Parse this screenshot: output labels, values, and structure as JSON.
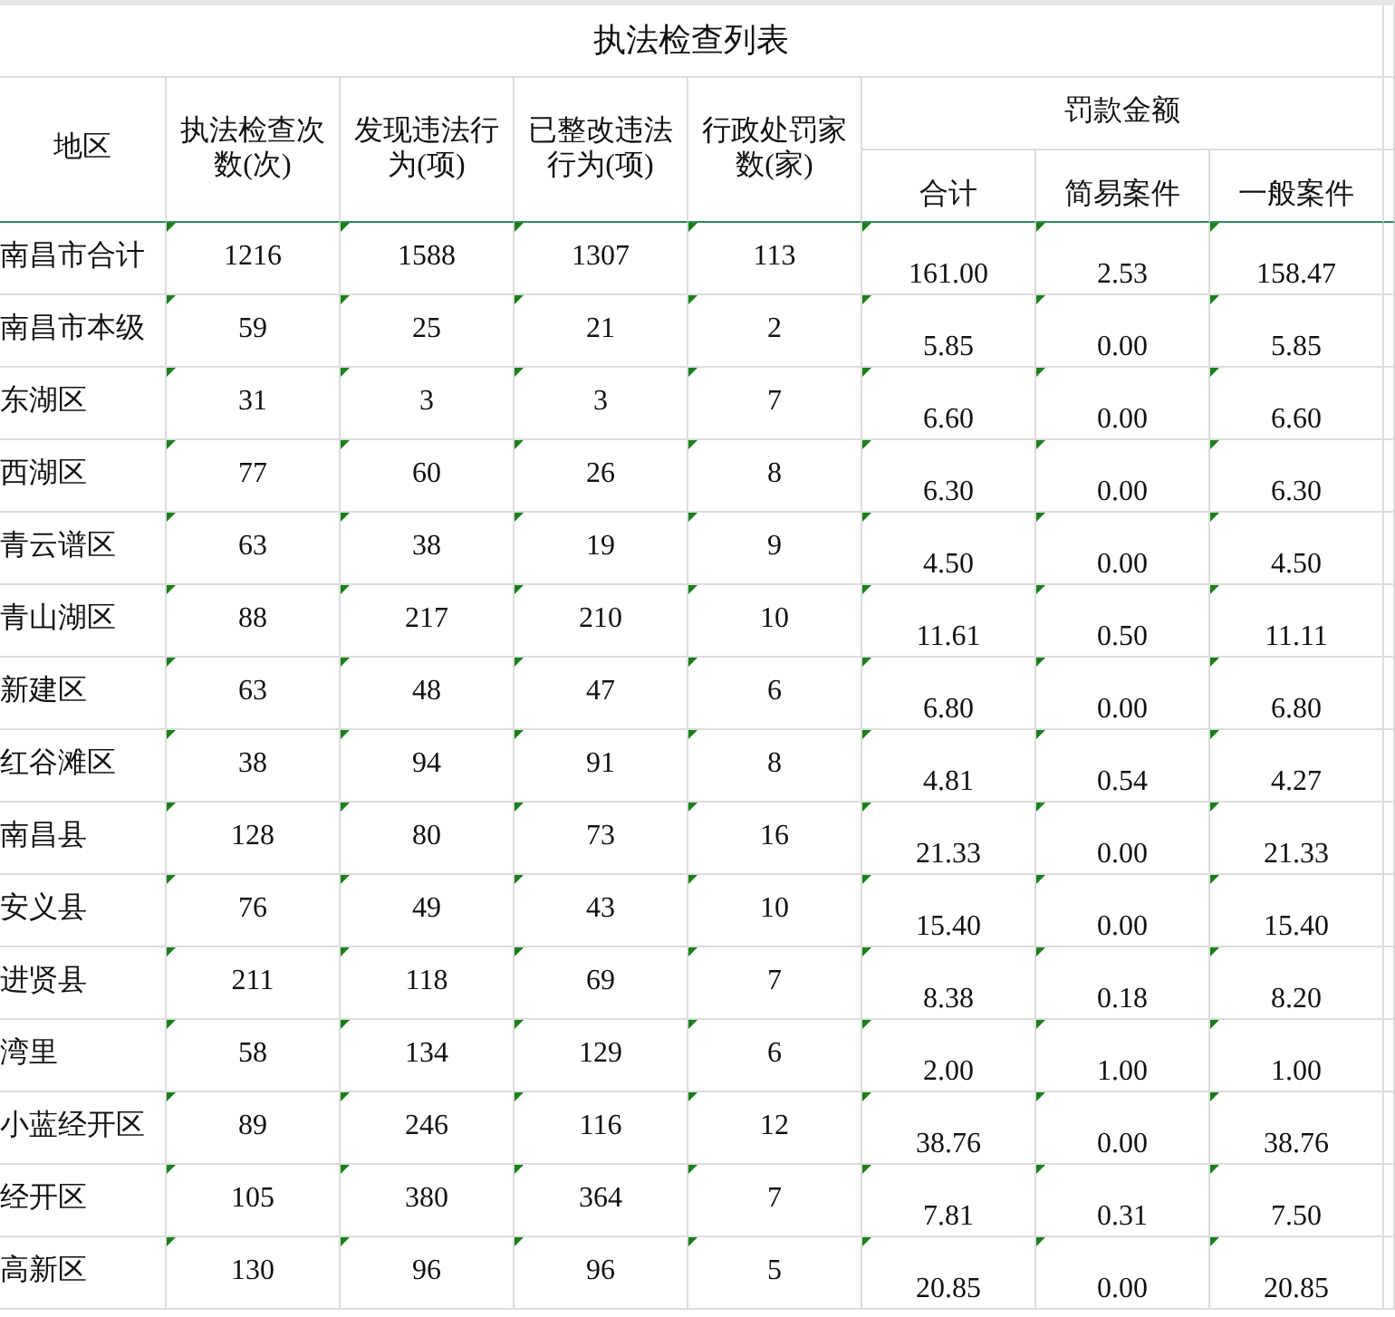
{
  "title": "执法检查列表",
  "headers": {
    "region": "地区",
    "counts": [
      "执法检查次数(次)",
      "发现违法行为(项)",
      "已整改违法行为(项)",
      "行政处罚家数(家)"
    ],
    "fines_group": "罚款金额",
    "fines": [
      "合计",
      "简易案件",
      "一般案件"
    ]
  },
  "rows": [
    {
      "region": "南昌市合计",
      "counts": [
        "1216",
        "1588",
        "1307",
        "113"
      ],
      "fines": [
        "161.00",
        "2.53",
        "158.47"
      ]
    },
    {
      "region": "南昌市本级",
      "counts": [
        "59",
        "25",
        "21",
        "2"
      ],
      "fines": [
        "5.85",
        "0.00",
        "5.85"
      ]
    },
    {
      "region": "东湖区",
      "counts": [
        "31",
        "3",
        "3",
        "7"
      ],
      "fines": [
        "6.60",
        "0.00",
        "6.60"
      ]
    },
    {
      "region": "西湖区",
      "counts": [
        "77",
        "60",
        "26",
        "8"
      ],
      "fines": [
        "6.30",
        "0.00",
        "6.30"
      ]
    },
    {
      "region": "青云谱区",
      "counts": [
        "63",
        "38",
        "19",
        "9"
      ],
      "fines": [
        "4.50",
        "0.00",
        "4.50"
      ]
    },
    {
      "region": "青山湖区",
      "counts": [
        "88",
        "217",
        "210",
        "10"
      ],
      "fines": [
        "11.61",
        "0.50",
        "11.11"
      ]
    },
    {
      "region": "新建区",
      "counts": [
        "63",
        "48",
        "47",
        "6"
      ],
      "fines": [
        "6.80",
        "0.00",
        "6.80"
      ]
    },
    {
      "region": "红谷滩区",
      "counts": [
        "38",
        "94",
        "91",
        "8"
      ],
      "fines": [
        "4.81",
        "0.54",
        "4.27"
      ]
    },
    {
      "region": "南昌县",
      "counts": [
        "128",
        "80",
        "73",
        "16"
      ],
      "fines": [
        "21.33",
        "0.00",
        "21.33"
      ]
    },
    {
      "region": "安义县",
      "counts": [
        "76",
        "49",
        "43",
        "10"
      ],
      "fines": [
        "15.40",
        "0.00",
        "15.40"
      ]
    },
    {
      "region": "进贤县",
      "counts": [
        "211",
        "118",
        "69",
        "7"
      ],
      "fines": [
        "8.38",
        "0.18",
        "8.20"
      ]
    },
    {
      "region": "湾里",
      "counts": [
        "58",
        "134",
        "129",
        "6"
      ],
      "fines": [
        "2.00",
        "1.00",
        "1.00"
      ]
    },
    {
      "region": "小蓝经开区",
      "counts": [
        "89",
        "246",
        "116",
        "12"
      ],
      "fines": [
        "38.76",
        "0.00",
        "38.76"
      ]
    },
    {
      "region": "经开区",
      "counts": [
        "105",
        "380",
        "364",
        "7"
      ],
      "fines": [
        "7.81",
        "0.31",
        "7.50"
      ]
    },
    {
      "region": "高新区",
      "counts": [
        "130",
        "96",
        "96",
        "5"
      ],
      "fines": [
        "20.85",
        "0.00",
        "20.85"
      ]
    }
  ]
}
